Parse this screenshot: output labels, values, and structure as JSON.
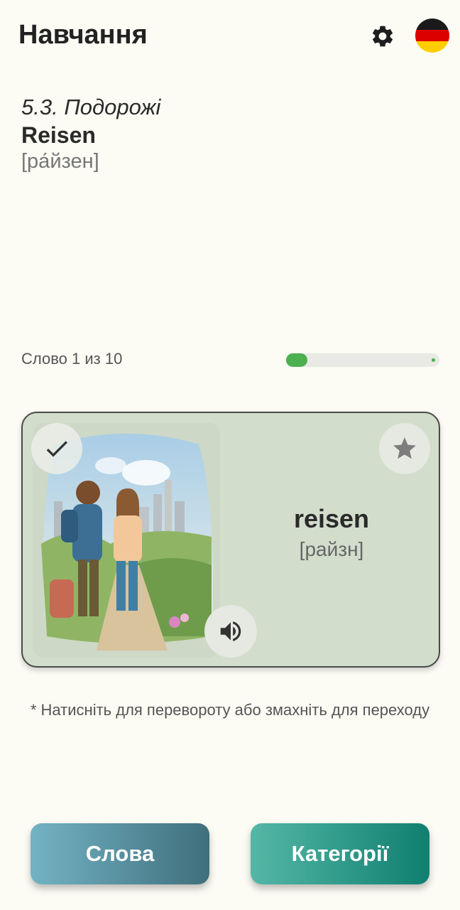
{
  "header": {
    "title": "Навчання",
    "settings_icon": "gear-icon",
    "language_icon": "german-flag-icon"
  },
  "topic": {
    "code": "5.3. Подорожі",
    "word": "Reisen",
    "transcription": "[ра́йзен]"
  },
  "progress": {
    "label": "Слово 1 из 10",
    "current": 1,
    "total": 10,
    "fill_fraction": 0.1,
    "color": "#4caf50"
  },
  "card": {
    "word": "reisen",
    "transcription": "[райзн]",
    "illustration": "two-travelers-illustration",
    "check_icon": "check-icon",
    "star_icon": "star-icon",
    "sound_icon": "speaker-icon",
    "background": "#d2ddcc"
  },
  "hint": "* Натисніть для перевороту або змахніть для переходу",
  "buttons": {
    "words": "Слова",
    "categories": "Категорії"
  }
}
